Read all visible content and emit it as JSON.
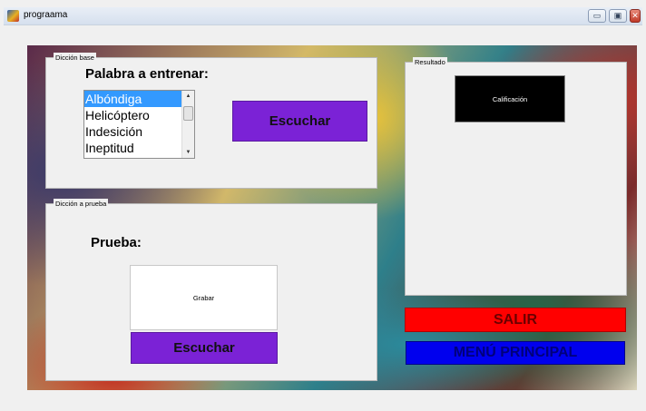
{
  "window": {
    "title": "prograama",
    "minimize_glyph": "▭",
    "restore_glyph": "▣",
    "close_glyph": "✕"
  },
  "panel_base": {
    "title": "Dicción base",
    "heading": "Palabra a entrenar:",
    "list_items": [
      "Albóndiga",
      "Helicóptero",
      "Indesición",
      "Ineptitud"
    ],
    "selected_index": 0,
    "scroll_up_glyph": "▲",
    "scroll_down_glyph": "▼",
    "listen_button": "Escuchar"
  },
  "panel_prueba": {
    "title": "Dicción a prueba",
    "heading": "Prueba:",
    "record_button": "Grabar",
    "listen_button": "Escuchar"
  },
  "panel_result": {
    "title": "Resultado",
    "score_label": "Calificación"
  },
  "actions": {
    "exit_button": "SALIR",
    "main_menu_button": "MENÚ PRINCIPAL"
  },
  "colors": {
    "purple_button": "#7b22d6",
    "exit_red": "#ff0000",
    "menu_blue": "#0000ee",
    "list_selection": "#3399ff"
  },
  "icons": {
    "app": "matlab-icon",
    "minimize": "minimize-icon",
    "restore": "restore-icon",
    "close": "close-icon"
  }
}
